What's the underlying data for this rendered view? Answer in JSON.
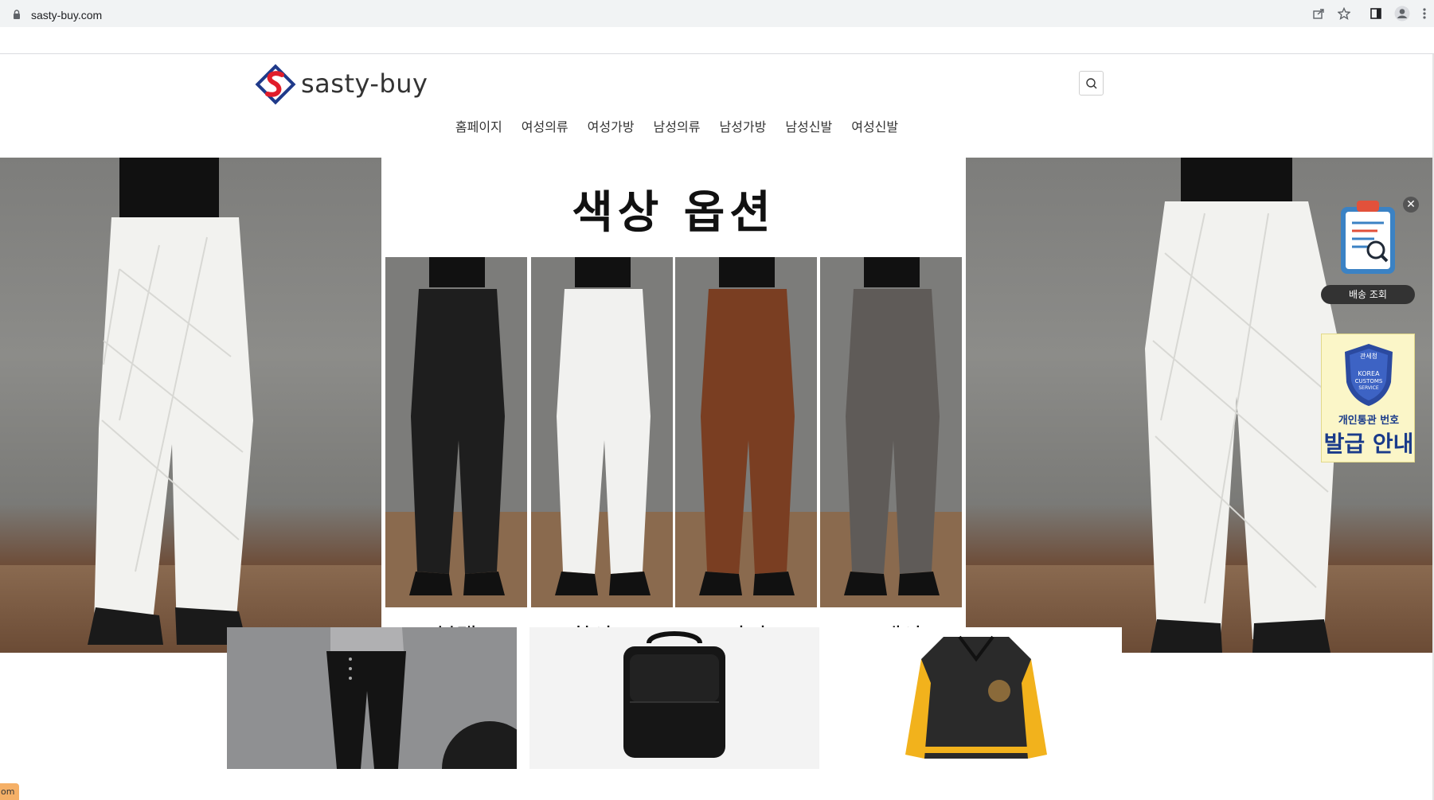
{
  "browser": {
    "url": "sasty-buy.com"
  },
  "site": {
    "logo_text": "sasty-buy",
    "nav": [
      "홈페이지",
      "여성의류",
      "여성가방",
      "남성의류",
      "남성가방",
      "남성신발",
      "여성신발"
    ]
  },
  "banner": {
    "title": "색상 옵션",
    "swatches": [
      {
        "label": "블랙",
        "color": "#1e1e1e"
      },
      {
        "label": "화이트",
        "color": "#f1f1ef"
      },
      {
        "label": "카피",
        "color": "#7a3e22"
      },
      {
        "label": "그레이",
        "color": "#5f5b58"
      }
    ]
  },
  "widgets": {
    "close": "✕",
    "track_label": "배송 조회",
    "customs_badge_lines": [
      "관세청",
      "KOREA",
      "CUSTOMS",
      "SERVICE"
    ],
    "customs_line1": "개인통관 번호",
    "customs_line2": "발급 안내"
  },
  "products": [
    {
      "name": "women-jeans"
    },
    {
      "name": "leather-bag"
    },
    {
      "name": "varsity-jacket"
    }
  ],
  "status_tab": "om"
}
